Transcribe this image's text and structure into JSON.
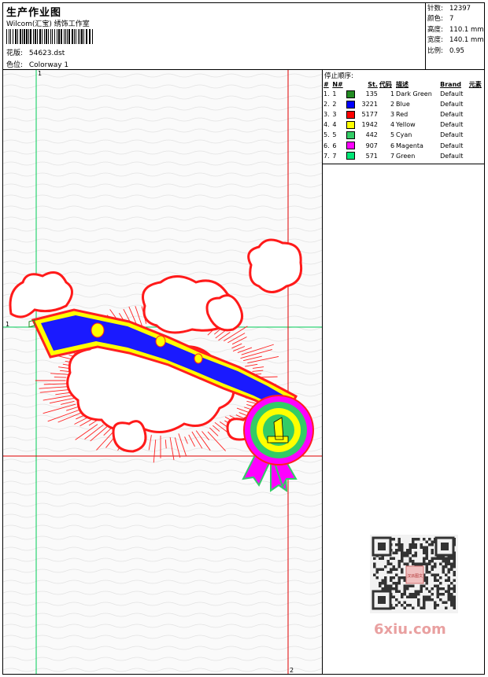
{
  "header": {
    "title": "生产作业图",
    "company": "Wilcom(汇宝) 绣饰工作室",
    "design_label": "花版:",
    "design_value": "54623.dst",
    "colorway_label": "色位:",
    "colorway_value": "Colorway 1"
  },
  "stats": [
    {
      "label": "针数:",
      "value": "12397"
    },
    {
      "label": "颜色:",
      "value": "7"
    },
    {
      "label": "高度:",
      "value": "110.1 mm"
    },
    {
      "label": "宽度:",
      "value": "140.1 mm"
    },
    {
      "label": "比例:",
      "value": "0.95"
    }
  ],
  "canvas": {
    "tick_top": "1",
    "tick_left": "1",
    "tick_bottom": "2"
  },
  "stop_sequence": {
    "title": "停止顺序:",
    "columns": [
      "#",
      "N#",
      "St.",
      "代码",
      "描述",
      "Brand",
      "元素"
    ],
    "rows": [
      {
        "idx": "1.",
        "n": "1",
        "color": "#228B22",
        "st": "135",
        "code": "1",
        "desc": "Dark Green",
        "brand": "Default"
      },
      {
        "idx": "2.",
        "n": "2",
        "color": "#0000FF",
        "st": "3221",
        "code": "2",
        "desc": "Blue",
        "brand": "Default"
      },
      {
        "idx": "3.",
        "n": "3",
        "color": "#FF0000",
        "st": "5177",
        "code": "3",
        "desc": "Red",
        "brand": "Default"
      },
      {
        "idx": "4.",
        "n": "4",
        "color": "#FFFF00",
        "st": "1942",
        "code": "4",
        "desc": "Yellow",
        "brand": "Default"
      },
      {
        "idx": "5.",
        "n": "5",
        "color": "#33CC66",
        "st": "442",
        "code": "5",
        "desc": "Cyan",
        "brand": "Default"
      },
      {
        "idx": "6.",
        "n": "6",
        "color": "#FF00FF",
        "st": "907",
        "code": "6",
        "desc": "Magenta",
        "brand": "Default"
      },
      {
        "idx": "7.",
        "n": "7",
        "color": "#00E676",
        "st": "571",
        "code": "7",
        "desc": "Green",
        "brand": "Default"
      }
    ]
  },
  "watermark": {
    "text": "6xiu.com",
    "stamp": "汉派图文"
  }
}
